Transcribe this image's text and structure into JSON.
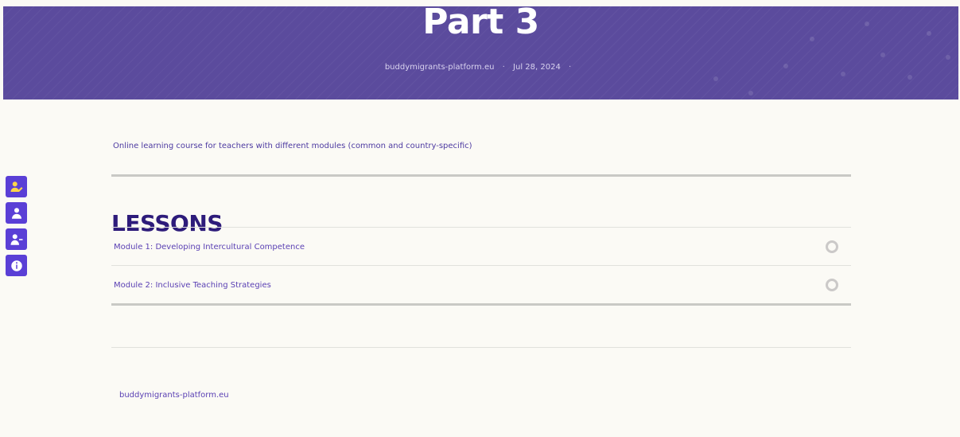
{
  "hero": {
    "title": "Part 3",
    "site": "buddymigrants-platform.eu",
    "date": "Jul 28, 2024",
    "separator_1": "·",
    "separator_2": "·"
  },
  "sidebar": {
    "items": [
      {
        "icon": "user-edit-icon"
      },
      {
        "icon": "user-icon"
      },
      {
        "icon": "user-minus-icon"
      },
      {
        "icon": "info-icon"
      }
    ]
  },
  "content": {
    "intro": "Online learning course for teachers with different modules (common and country-specific)",
    "lessons_title": "LESSONS",
    "lessons": [
      {
        "label": "Module 1: Developing Intercultural Competence",
        "status_icon": "incomplete-circle-icon"
      },
      {
        "label": "Module 2: Inclusive Teaching Strategies",
        "status_icon": "incomplete-circle-icon"
      }
    ]
  },
  "footer": {
    "site": "buddymigrants-platform.eu"
  },
  "colors": {
    "hero_bg": "#5b4b9d",
    "accent": "#5a3fd6",
    "heading": "#2d1b7a",
    "link_text": "#5b41b4",
    "page_bg": "#fbfaf5"
  }
}
